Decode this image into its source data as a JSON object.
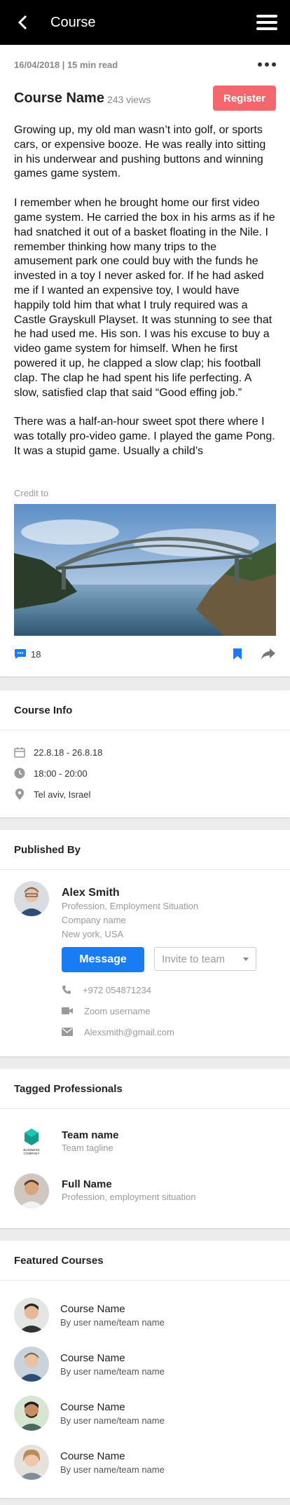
{
  "header": {
    "title": "Course"
  },
  "article": {
    "date": "16/04/2018",
    "read_time": "15 min read",
    "course_name": "Course Name",
    "views": "243 views",
    "register_label": "Register",
    "paragraphs": [
      "Growing up, my old man wasn’t into golf, or sports cars, or expensive booze. He was really into sitting in his underwear and pushing buttons and winning games game system.",
      "I remember when he brought home our first video game system. He carried the box in his arms as if he had snatched it out of a basket floating in the Nile. I remember thinking how many trips to the amusement park one could buy with the funds he invested in a toy I never asked for. If he had asked me if I wanted an expensive toy, I would have happily told him that what I truly required was a Castle Grayskull Playset. It was stunning to see that he had used me. His son. I was his excuse to buy a video game system for himself. When he first powered it up, he clapped a slow clap; his football clap. The clap he had spent his life perfecting. A slow, satisfied clap that said “Good effing job.”",
      "There was a half-an-hour sweet spot there where I was totally pro-video game. I played the game Pong. It was a stupid game. Usually a child’s"
    ],
    "credit": "Credit to",
    "comment_count": "18"
  },
  "course_info": {
    "title": "Course Info",
    "dates": "22.8.18 - 26.8.18",
    "time": "18:00 - 20:00",
    "location": "Tel aviv, Israel"
  },
  "published_by": {
    "title": "Published By",
    "name": "Alex Smith",
    "profession": "Profession, Employment Situation",
    "company": "Company name",
    "city": "New york, USA",
    "message_label": "Message",
    "invite_placeholder": "Invite to team",
    "phone": "+972 054871234",
    "zoom": "Zoom username",
    "email": "Alexsmith@gmail.com"
  },
  "tagged": {
    "title": "Tagged Professionals",
    "items": [
      {
        "name": "Team name",
        "sub": "Team tagline",
        "logo_text": "BUSINESS COMPANY"
      },
      {
        "name": "Full Name",
        "sub": "Profession, employment situation"
      }
    ]
  },
  "featured": {
    "title": "Featured Courses",
    "items": [
      {
        "name": "Course Name",
        "sub": "By user name/team name"
      },
      {
        "name": "Course Name",
        "sub": "By user name/team name"
      },
      {
        "name": "Course Name",
        "sub": "By user name/team name"
      },
      {
        "name": "Course Name",
        "sub": "By user name/team name"
      }
    ]
  },
  "colors": {
    "register": "#f4676e",
    "accent_blue": "#1a7cf2",
    "header_bg": "#000000"
  }
}
